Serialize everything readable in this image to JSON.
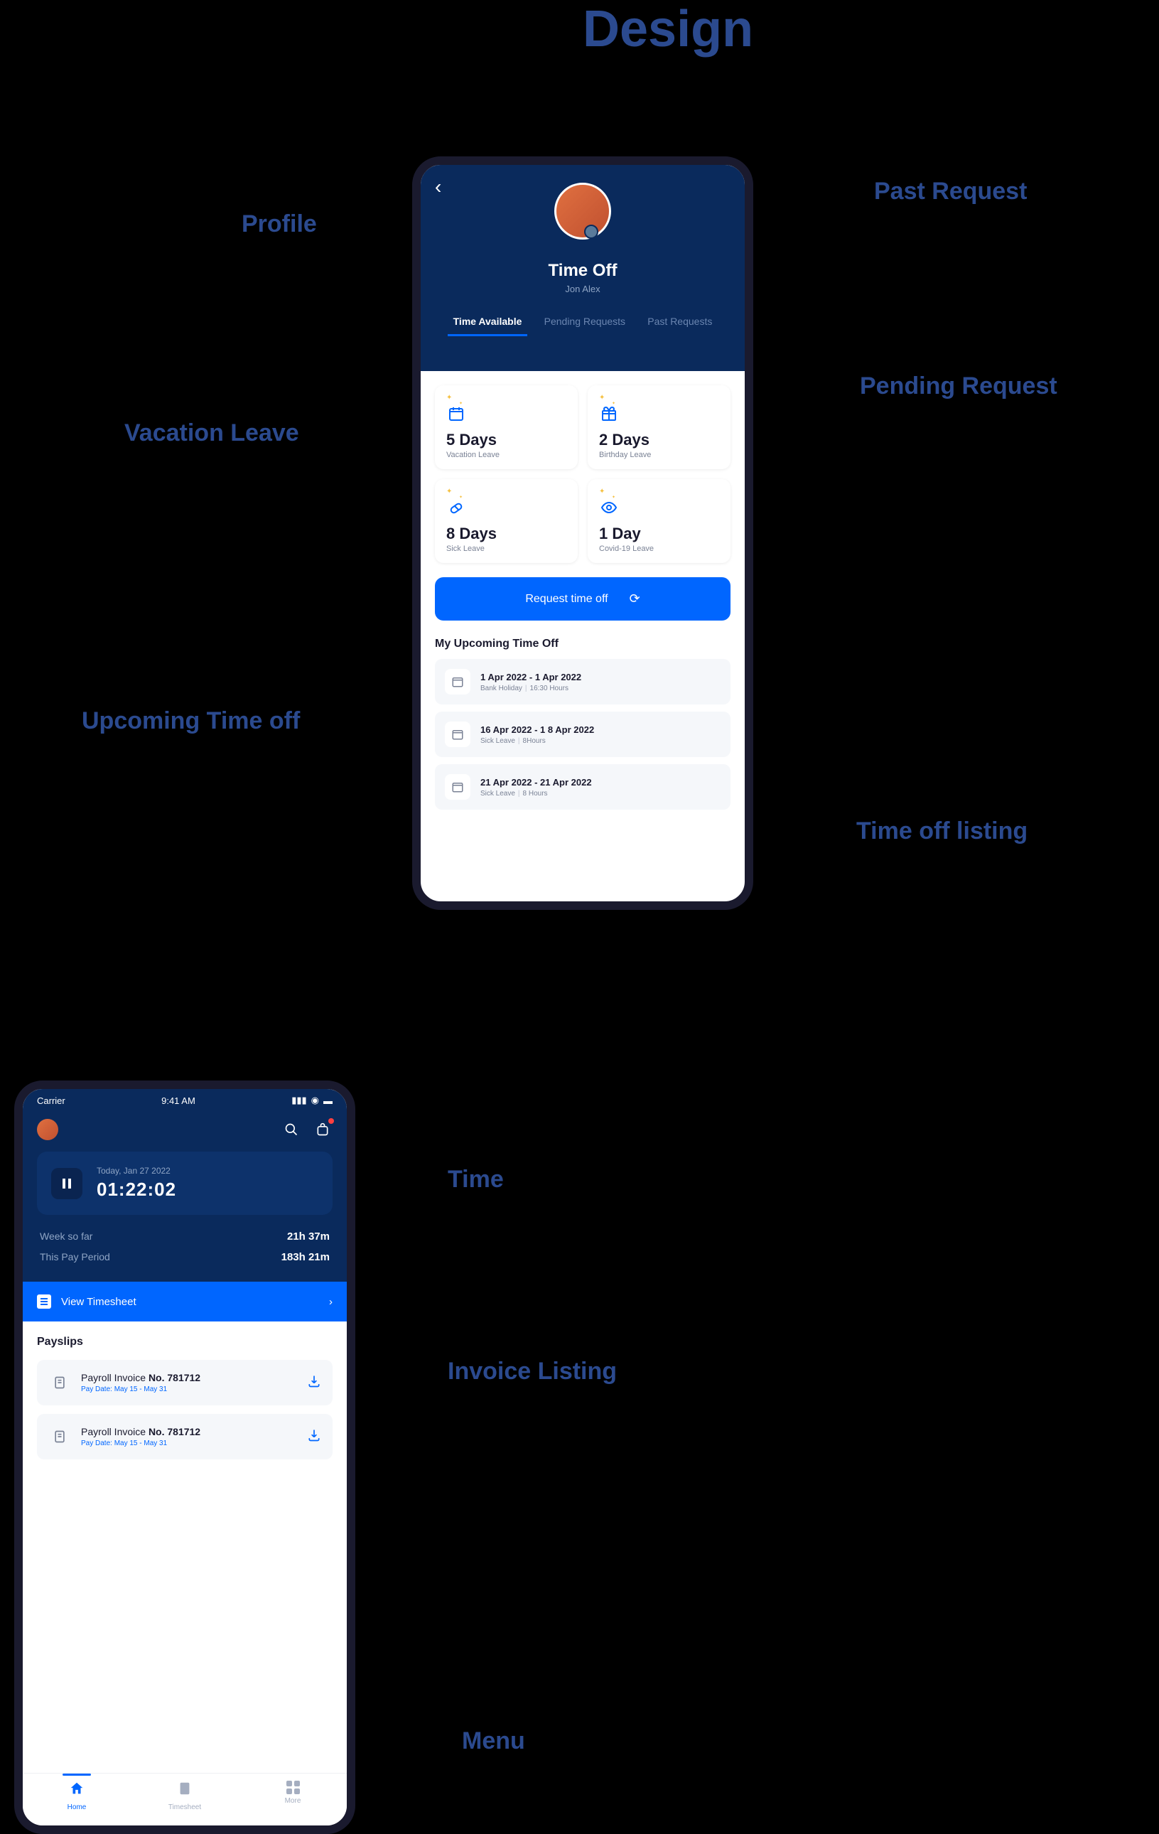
{
  "design_title": "Design",
  "annotations": {
    "profile": "Profile",
    "past_request": "Past Request",
    "pending_request": "Pending Request",
    "vacation_leave": "Vacation Leave",
    "upcoming_time_off": "Upcoming Time off",
    "time_off_listing": "Time off listing",
    "time": "Time",
    "invoice_listing": "Invoice Listing",
    "menu": "Menu"
  },
  "phone1": {
    "title": "Time Off",
    "subtitle": "Jon Alex",
    "tabs": {
      "time_available": "Time Available",
      "pending_requests": "Pending Requests",
      "past_requests": "Past Requests"
    },
    "cards": [
      {
        "days": "5 Days",
        "label": "Vacation Leave",
        "icon": "calendar"
      },
      {
        "days": "2 Days",
        "label": "Birthday Leave",
        "icon": "gift"
      },
      {
        "days": "8 Days",
        "label": "Sick Leave",
        "icon": "pill"
      },
      {
        "days": "1 Day",
        "label": "Covid-19 Leave",
        "icon": "eye"
      }
    ],
    "request_button": "Request time off",
    "upcoming_title": "My Upcoming Time Off",
    "upcoming": [
      {
        "dates": "1 Apr 2022 - 1 Apr 2022",
        "type": "Bank Holiday",
        "hours": "16:30 Hours"
      },
      {
        "dates": "16 Apr 2022 - 1 8 Apr 2022",
        "type": "Sick Leave",
        "hours": "8Hours"
      },
      {
        "dates": "21 Apr 2022 - 21 Apr 2022",
        "type": "Sick Leave",
        "hours": "8 Hours"
      }
    ]
  },
  "phone2": {
    "status": {
      "carrier": "Carrier",
      "time": "9:41 AM"
    },
    "timer": {
      "date": "Today, Jan 27 2022",
      "time": "01:22:02"
    },
    "stats": {
      "week_label": "Week so far",
      "week_value": "21h 37m",
      "period_label": "This Pay Period",
      "period_value": "183h 21m"
    },
    "view_timesheet": "View Timesheet",
    "payslips_title": "Payslips",
    "payslips": [
      {
        "prefix": "Payroll Invoice ",
        "no": "No. 781712",
        "date": "Pay Date: May 15 - May 31"
      },
      {
        "prefix": "Payroll Invoice ",
        "no": "No. 781712",
        "date": "Pay Date: May 15 - May 31"
      }
    ],
    "tabbar": {
      "home": "Home",
      "timesheet": "Timesheet",
      "more": "More"
    }
  }
}
